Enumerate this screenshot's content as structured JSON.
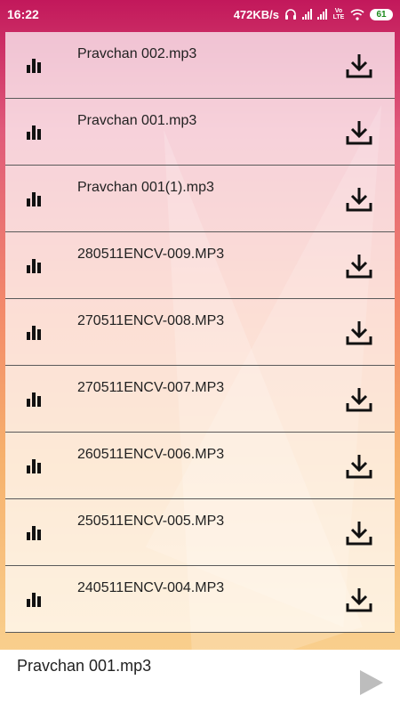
{
  "status": {
    "time": "16:22",
    "speed": "472KB/s",
    "volte": "Vo LTE",
    "battery": "61"
  },
  "files": [
    {
      "name": "Pravchan 002.mp3"
    },
    {
      "name": "Pravchan 001.mp3"
    },
    {
      "name": "Pravchan 001(1).mp3"
    },
    {
      "name": "280511ENCV-009.MP3"
    },
    {
      "name": "270511ENCV-008.MP3"
    },
    {
      "name": "270511ENCV-007.MP3"
    },
    {
      "name": "260511ENCV-006.MP3"
    },
    {
      "name": "250511ENCV-005.MP3"
    },
    {
      "name": "240511ENCV-004.MP3"
    }
  ],
  "player": {
    "now_playing": "Pravchan 001.mp3"
  },
  "icons": {
    "row_leading": "equalizer-bars-icon",
    "row_action": "download-icon",
    "player_action": "play-icon"
  }
}
